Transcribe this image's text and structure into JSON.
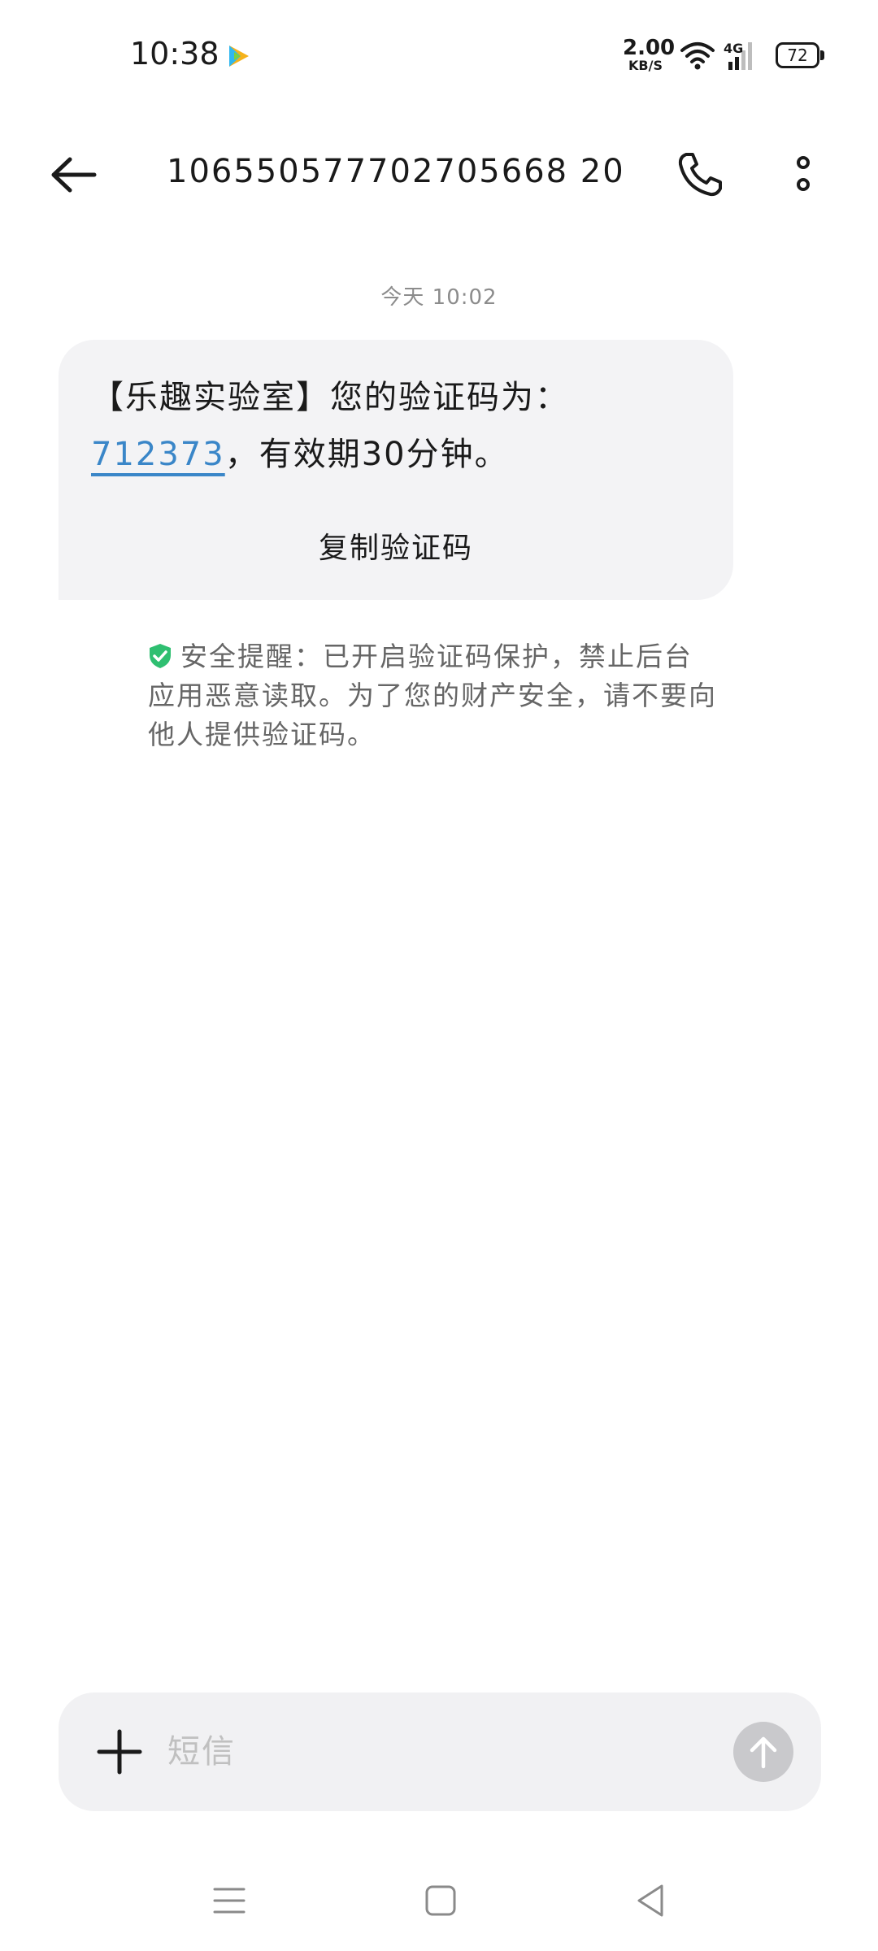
{
  "status_bar": {
    "time": "10:38",
    "net_speed_value": "2.00",
    "net_speed_unit": "KB/S",
    "network_type": "4G",
    "battery_level": "72",
    "icons": [
      "video-app-icon",
      "wifi-icon",
      "signal-icon",
      "battery-icon"
    ]
  },
  "header": {
    "title": "106550577702705668 20",
    "back_icon": "arrow-left-icon",
    "call_icon": "phone-icon",
    "more_icon": "more-vertical-icon"
  },
  "conversation": {
    "date_label": "今天 10:02",
    "message": {
      "prefix": "【乐趣实验室】您的验证码为：",
      "code": "712373",
      "suffix": "，有效期30分钟。"
    },
    "copy_label": "复制验证码",
    "security_note": "安全提醒：已开启验证码保护，禁止后台应用恶意读取。为了您的财产安全，请不要向他人提供验证码。"
  },
  "composer": {
    "placeholder": "短信",
    "add_icon": "plus-icon",
    "send_icon": "arrow-up-icon"
  },
  "colors": {
    "accent_link": "#3a86c8",
    "shield_green": "#2fbf71",
    "bubble_bg": "#f3f3f5"
  }
}
